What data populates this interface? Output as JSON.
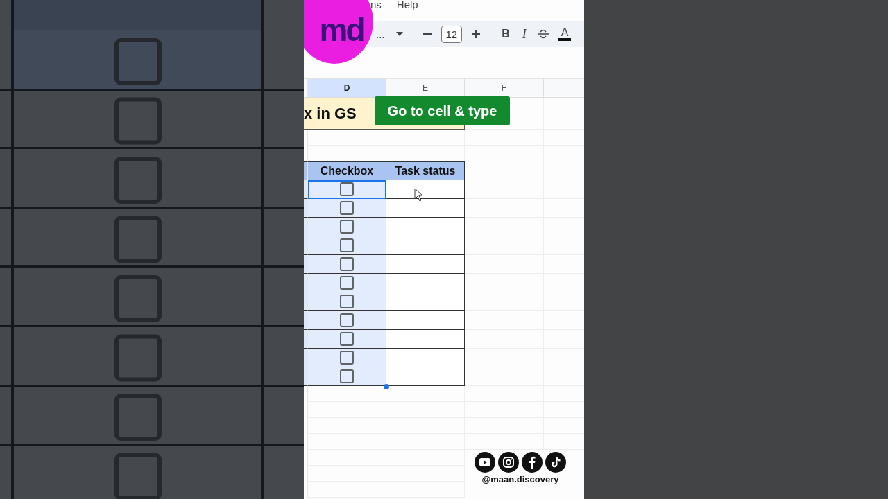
{
  "menu": [
    "ns",
    "Help"
  ],
  "logo": {
    "text": "md"
  },
  "toolbar": {
    "font": "...",
    "font_size": "12",
    "bold": "B",
    "italic": "I",
    "text_color": "A"
  },
  "columns": [
    {
      "label": "D",
      "selected": true
    },
    {
      "label": "E",
      "selected": false
    },
    {
      "label": "F",
      "selected": false
    }
  ],
  "title_cell": "x in GS",
  "callout": "Go to cell & type",
  "table": {
    "headers": [
      "Checkbox",
      "Task status"
    ],
    "rows": [
      {
        "checked": false,
        "selected": true
      },
      {
        "checked": false,
        "selected": false
      },
      {
        "checked": false,
        "selected": false
      },
      {
        "checked": false,
        "selected": false
      },
      {
        "checked": false,
        "selected": false
      },
      {
        "checked": false,
        "selected": false
      },
      {
        "checked": false,
        "selected": false
      },
      {
        "checked": false,
        "selected": false
      },
      {
        "checked": false,
        "selected": false
      },
      {
        "checked": false,
        "selected": false
      },
      {
        "checked": false,
        "selected": false
      }
    ]
  },
  "social_handle": "@maan.discovery"
}
